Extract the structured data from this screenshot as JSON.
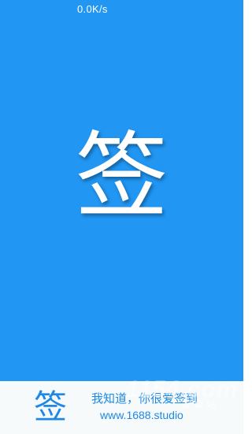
{
  "status_bar": {
    "net_speed": "0.0K/s"
  },
  "splash": {
    "logo_char": "签",
    "background_color": "#2196F3"
  },
  "footer": {
    "icon_char": "签",
    "slogan": "我知道，你很爱签到",
    "url": "www.1688.studio",
    "accent_color": "#1E88E5"
  },
  "watermark": {
    "mark": "1154.com",
    "sub": "安卓站"
  }
}
